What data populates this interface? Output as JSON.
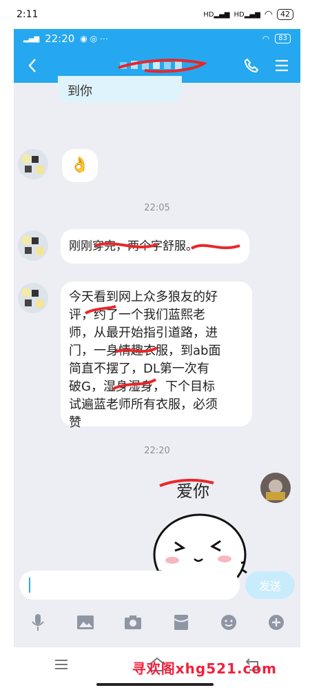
{
  "device_status": {
    "time": "2:11",
    "signal1": "HD",
    "signal2": "HD",
    "battery": "42"
  },
  "app_status": {
    "time": "22:20",
    "battery": "83"
  },
  "header": {
    "title": "",
    "back_icon": "back-icon",
    "call_icon": "phone-icon",
    "menu_icon": "menu-icon"
  },
  "messages": {
    "partial_top": "到你",
    "emoji": "👌",
    "time1": "22:05",
    "msg1": "刚刚穿完，两个字舒服。",
    "msg2_lines": [
      "今天看到网上众多狼友的好",
      "评，约了一个我们蓝熙老",
      "师，从最开始指引道路，进",
      "门，一身情趣衣服，到ab面",
      "简直不摆了，DL第一次有",
      "破G，湿身湿身，下个目标",
      "试遍蓝老师所有衣服，必须",
      "赞"
    ],
    "time2": "22:20",
    "sticker_text": "爱你"
  },
  "composer": {
    "placeholder": "",
    "send_label": "发送"
  },
  "toolbar_icons": [
    "mic-icon",
    "image-icon",
    "camera-icon",
    "red-packet-icon",
    "emoji-icon",
    "plus-icon"
  ],
  "navbar_icons": [
    "menu-icon",
    "home-icon",
    "back-icon"
  ],
  "watermark": "寻欢阁xhg521.com",
  "colors": {
    "accent": "#25a8ef",
    "background": "#eceef3",
    "watermark": "#f2203d"
  }
}
